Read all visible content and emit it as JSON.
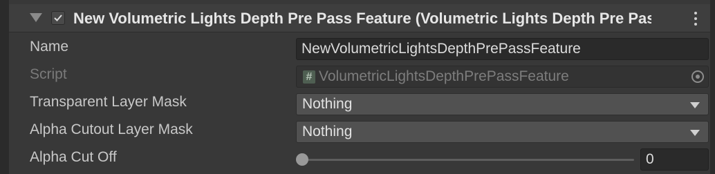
{
  "feature": {
    "enabled": true,
    "title": "New Volumetric Lights Depth Pre Pass Feature (Volumetric Lights Depth Pre Pass Feature)"
  },
  "icons": {
    "foldout": "foldout-expanded-triangle",
    "enabled_checkbox": "checkmark",
    "menu": "kebab-menu-vertical-dots",
    "script": "csharp-script-hash",
    "object_picker": "target-circle",
    "dropdown": "triangle-down"
  },
  "fields": {
    "name": {
      "label": "Name",
      "value": "NewVolumetricLightsDepthPrePassFeature"
    },
    "script": {
      "label": "Script",
      "icon_glyph": "#",
      "value": "VolumetricLightsDepthPrePassFeature"
    },
    "transparent_layer_mask": {
      "label": "Transparent Layer Mask",
      "value": "Nothing"
    },
    "alpha_cutout_layer_mask": {
      "label": "Alpha Cutout Layer Mask",
      "value": "Nothing"
    },
    "alpha_cut_off": {
      "label": "Alpha Cut Off",
      "value": "0",
      "slider_fraction": 0
    }
  },
  "colors": {
    "background": "#383838",
    "field_dark": "#2a2a2a",
    "dropdown": "#515151",
    "text": "#c8c8c8",
    "text_disabled": "#7a7a7a"
  }
}
